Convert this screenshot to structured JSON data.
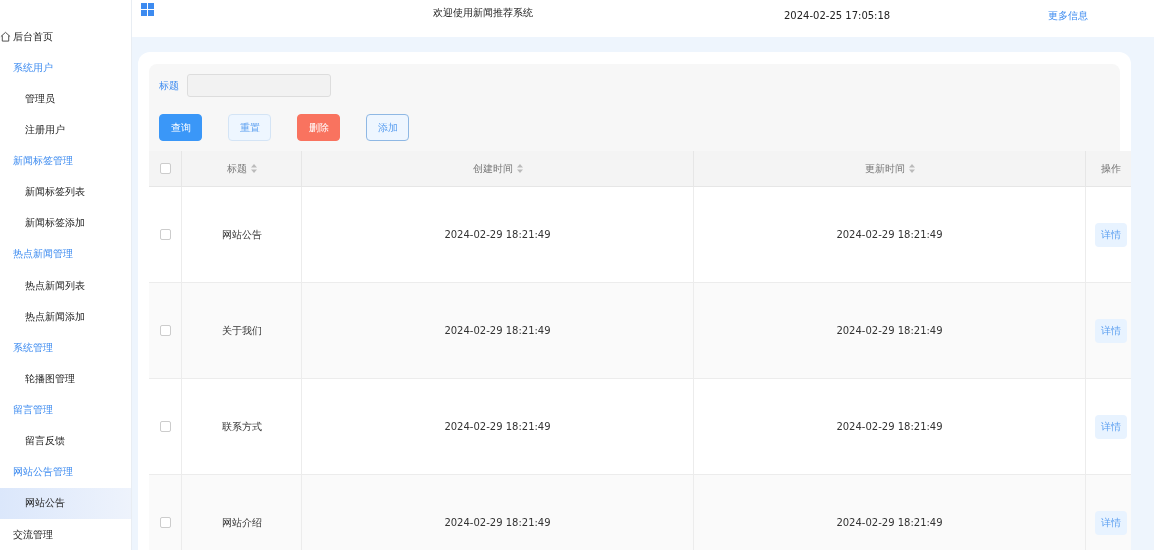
{
  "header": {
    "title": "欢迎使用新闻推荐系统",
    "datetime": "2024-02-25 17:05:18",
    "more_link": "更多信息"
  },
  "sidebar": {
    "items": [
      {
        "kind": "home",
        "label": "后台首页",
        "selected": false
      },
      {
        "kind": "group",
        "label": "系统用户",
        "children": [
          {
            "label": "管理员",
            "selected": false
          },
          {
            "label": "注册用户",
            "selected": false
          }
        ]
      },
      {
        "kind": "group",
        "label": "新闻标签管理",
        "children": [
          {
            "label": "新闻标签列表",
            "selected": false
          },
          {
            "label": "新闻标签添加",
            "selected": false
          }
        ]
      },
      {
        "kind": "group",
        "label": "热点新闻管理",
        "children": [
          {
            "label": "热点新闻列表",
            "selected": false
          },
          {
            "label": "热点新闻添加",
            "selected": false
          }
        ]
      },
      {
        "kind": "group",
        "label": "系统管理",
        "children": [
          {
            "label": "轮播图管理",
            "selected": false
          }
        ]
      },
      {
        "kind": "group",
        "label": "留言管理",
        "children": [
          {
            "label": "留言反馈",
            "selected": false
          }
        ]
      },
      {
        "kind": "group",
        "label": "网站公告管理",
        "children": [
          {
            "label": "网站公告",
            "selected": true
          }
        ]
      },
      {
        "kind": "link",
        "label": "交流管理",
        "selected": false
      }
    ]
  },
  "search": {
    "label": "标题"
  },
  "buttons": [
    {
      "kind": "primary",
      "label": "查询"
    },
    {
      "kind": "plain",
      "label": "重置"
    },
    {
      "kind": "danger",
      "label": "删除"
    },
    {
      "kind": "outline",
      "label": "添加"
    }
  ],
  "table": {
    "select_all_checked": false,
    "columns": [
      {
        "label": "标题",
        "sortable": true
      },
      {
        "label": "创建时间",
        "sortable": true
      },
      {
        "label": "更新时间",
        "sortable": true
      },
      {
        "label": "操作",
        "sortable": false
      }
    ],
    "rows": [
      {
        "checked": false,
        "title": "网站公告",
        "created": "2024-02-29 18:21:49",
        "updated": "2024-02-29 18:21:49",
        "action": "详情"
      },
      {
        "checked": false,
        "title": "关于我们",
        "created": "2024-02-29 18:21:49",
        "updated": "2024-02-29 18:21:49",
        "action": "详情"
      },
      {
        "checked": false,
        "title": "联系方式",
        "created": "2024-02-29 18:21:49",
        "updated": "2024-02-29 18:21:49",
        "action": "详情"
      },
      {
        "checked": false,
        "title": "网站介绍",
        "created": "2024-02-29 18:21:49",
        "updated": "2024-02-29 18:21:49",
        "action": "详情"
      }
    ]
  }
}
